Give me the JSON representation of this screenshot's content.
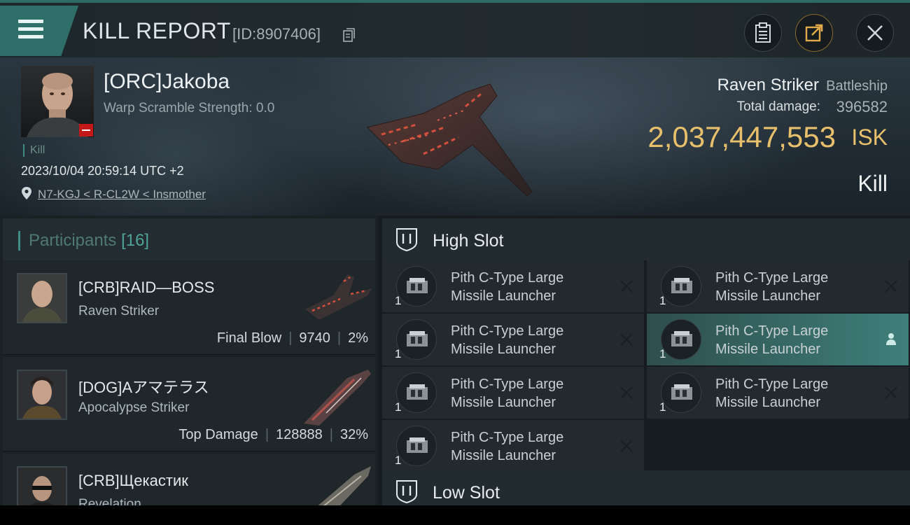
{
  "header": {
    "title": "KILL REPORT",
    "id_text": "[ID:8907406]",
    "icons": [
      "menu-icon",
      "copy-icon",
      "report-icon",
      "share-icon",
      "close-icon"
    ]
  },
  "victim": {
    "name": "[ORC]Jakoba",
    "warp_text": "Warp Scramble Strength: 0.0",
    "kill_tag": "Kill",
    "timestamp": "2023/10/04 20:59:14 UTC +2",
    "location": "N7-KGJ < R-CL2W < Insmother"
  },
  "summary": {
    "ship_name": "Raven Striker",
    "ship_class": "Battleship",
    "damage_label": "Total damage:",
    "damage_value": "396582",
    "isk_value": "2,037,447,553",
    "isk_unit": "ISK",
    "result": "Kill"
  },
  "participants": {
    "title": "Participants",
    "count": "[16]",
    "rows": [
      {
        "name": "[CRB]RAID—BOSS",
        "ship": "Raven Striker",
        "label": "Final Blow",
        "damage": "9740",
        "percent": "2%"
      },
      {
        "name": "[DOG]Aアマテラス",
        "ship": "Apocalypse Striker",
        "label": "Top Damage",
        "damage": "128888",
        "percent": "32%"
      },
      {
        "name": "[CRB]Щекастик",
        "ship": "Revelation",
        "label": "",
        "damage": "",
        "percent": ""
      }
    ]
  },
  "slots": {
    "high_label": "High Slot",
    "low_label": "Low Slot",
    "modules": [
      {
        "line1": "Pith C-Type Large",
        "line2": "Missile Launcher",
        "qty": "1"
      },
      {
        "line1": "Pith C-Type Large",
        "line2": "Missile Launcher",
        "qty": "1"
      },
      {
        "line1": "Pith C-Type Large",
        "line2": "Missile Launcher",
        "qty": "1"
      },
      {
        "line1": "Pith C-Type Large",
        "line2": "Missile Launcher",
        "qty": "1"
      },
      {
        "line1": "Pith C-Type Large",
        "line2": "Missile Launcher",
        "qty": "1"
      },
      {
        "line1": "Pith C-Type Large",
        "line2": "Missile Launcher",
        "qty": "1"
      },
      {
        "line1": "Pith C-Type Large",
        "line2": "Missile Launcher",
        "qty": "1"
      }
    ]
  },
  "colors": {
    "accent": "#3f8f86",
    "isk": "#e8c06c",
    "highlight": "#3e7f7a",
    "badge_red": "#c41818"
  }
}
